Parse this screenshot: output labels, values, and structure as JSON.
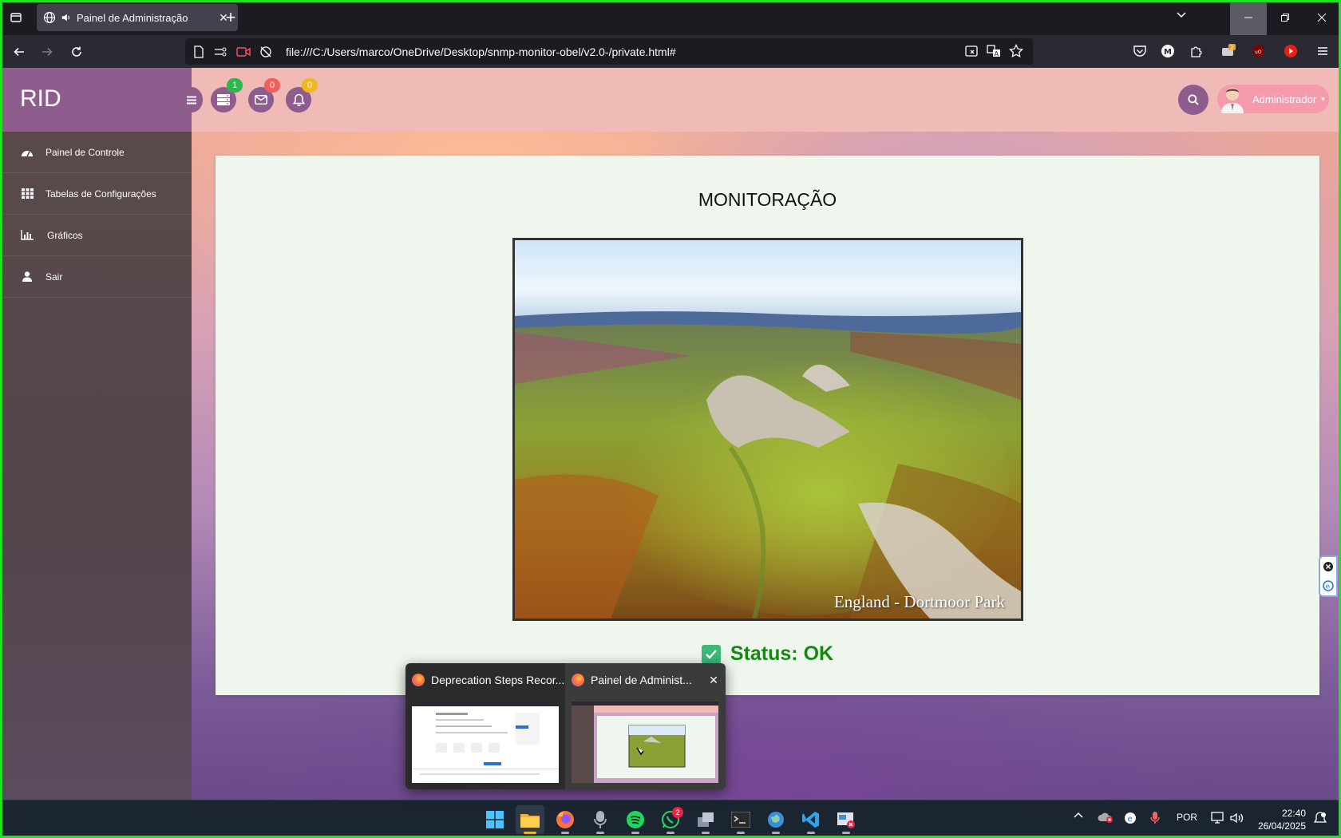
{
  "browser": {
    "tab_title": "Painel de Administração",
    "url": "file:///C:/Users/marco/OneDrive/Desktop/snmp-monitor-obel/v2.0-/private.html#",
    "toolbar_badge_count": "2"
  },
  "sidebar": {
    "brand": "RID",
    "items": [
      {
        "label": "Painel de Controle",
        "icon": "dashboard-icon"
      },
      {
        "label": "Tabelas de Configurações",
        "icon": "grid-icon"
      },
      {
        "label": "Gráficos",
        "icon": "bar-chart-icon"
      },
      {
        "label": "Sair",
        "icon": "user-icon"
      }
    ]
  },
  "topbar": {
    "tasks_badge": "1",
    "messages_badge": "0",
    "notifications_badge": "0",
    "user_name": "Administrador"
  },
  "main": {
    "title": "MONITORAÇÃO",
    "image_caption": "England - Dortmoor Park",
    "status_text": "Status: OK"
  },
  "thumbnails": [
    {
      "title": "Deprecation Steps Recor..."
    },
    {
      "title": "Painel de Administ..."
    }
  ],
  "taskbar": {
    "whatsapp_badge": "2",
    "language": "POR",
    "time": "22:40",
    "date": "26/04/2025"
  },
  "colors": {
    "sidebar_brand": "#8e5d8e",
    "topbar": "#f0bab6",
    "status_ok": "#128a12",
    "badge_green": "#2db84d",
    "badge_red": "#f0605a",
    "badge_yellow": "#f0b820"
  }
}
